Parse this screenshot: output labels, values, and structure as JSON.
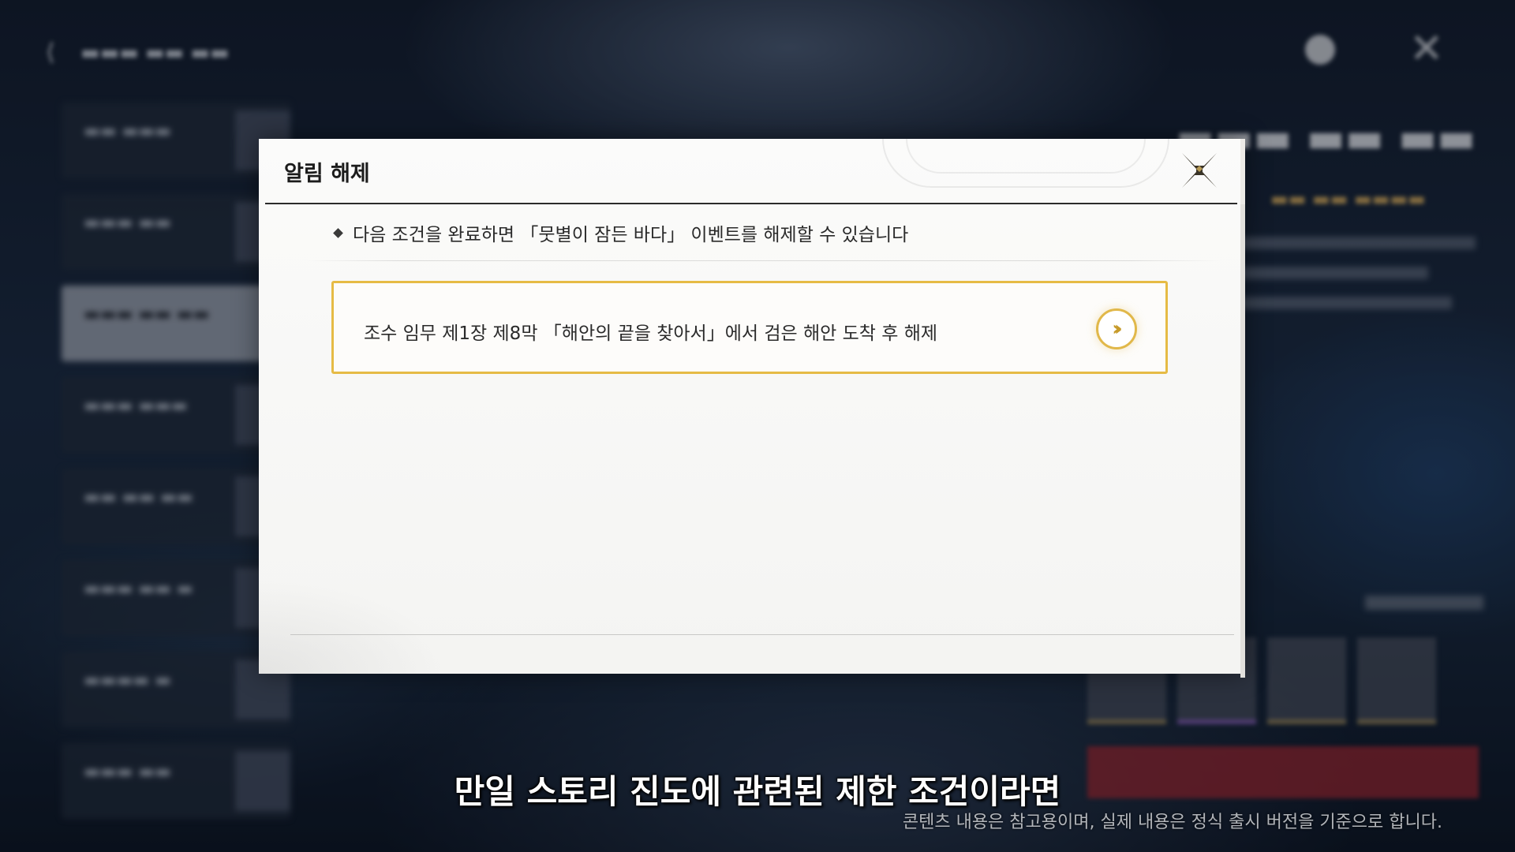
{
  "modal": {
    "title": "알림 해제",
    "info_text": "다음 조건을 완료하면 「뭇별이 잠든 바다」 이벤트를 해제할 수 있습니다",
    "condition_text": "조수 임무 제1장 제8막 「해안의 끝을 찾아서」에서 검은 해안 도착 후 해제"
  },
  "overlay": {
    "subtitle": "만일 스토리 진도에 관련된 제한 조건이라면",
    "disclaimer": "콘텐츠 내용은 참고용이며, 실제 내용은 정식 출시 버전을 기준으로 합니다."
  },
  "icons": {
    "close": "close-x-icon",
    "go": "double-chevron-right-icon",
    "bullet": "diamond-bullet-icon"
  },
  "colors": {
    "accent_gold": "#e6bb45",
    "modal_bg": "#f8f8f6",
    "title_text": "#1c1c1c"
  }
}
